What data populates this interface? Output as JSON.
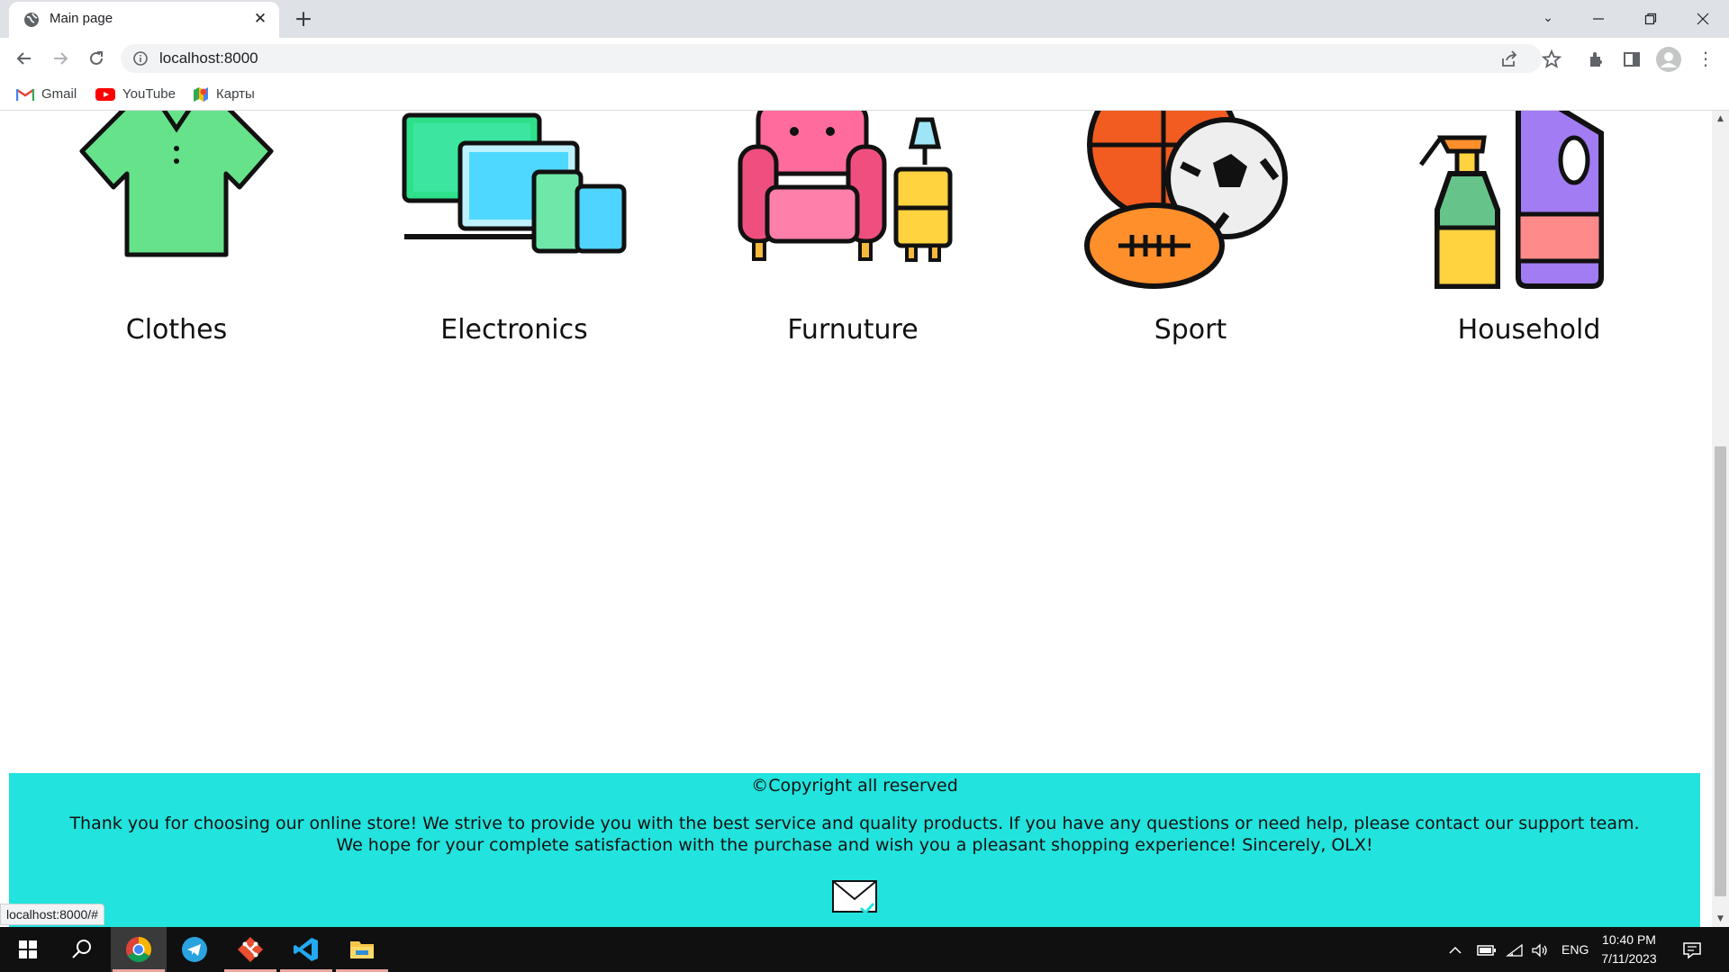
{
  "browser": {
    "tab_title": "Main page",
    "url": "localhost:8000",
    "bookmarks": [
      {
        "label": "Gmail",
        "icon": "gmail-icon"
      },
      {
        "label": "YouTube",
        "icon": "youtube-icon"
      },
      {
        "label": "Карты",
        "icon": "maps-icon"
      }
    ],
    "status_url": "localhost:8000/#"
  },
  "categories": [
    {
      "label": "Clothes",
      "icon": "shirt-icon"
    },
    {
      "label": "Electronics",
      "icon": "devices-icon"
    },
    {
      "label": "Furnuture",
      "icon": "armchair-icon"
    },
    {
      "label": "Sport",
      "icon": "balls-icon"
    },
    {
      "label": "Household",
      "icon": "cleaning-supplies-icon"
    }
  ],
  "footer": {
    "copyright": "©Copyright all reserved",
    "message": "Thank you for choosing our online store! We strive to provide you with the best service and quality products. If you have any questions or need help, please contact our support team. We hope for your complete satisfaction with the purchase and wish you a pleasant shopping experience! Sincerely, OLX!",
    "mail_icon": "mail-icon",
    "background": "#22e3dd"
  },
  "taskbar": {
    "apps": [
      "start-icon",
      "search-icon",
      "chrome-icon",
      "telegram-icon",
      "git-icon",
      "vscode-icon",
      "file-explorer-icon"
    ],
    "language": "ENG",
    "time": "10:40 PM",
    "date": "7/11/2023"
  }
}
